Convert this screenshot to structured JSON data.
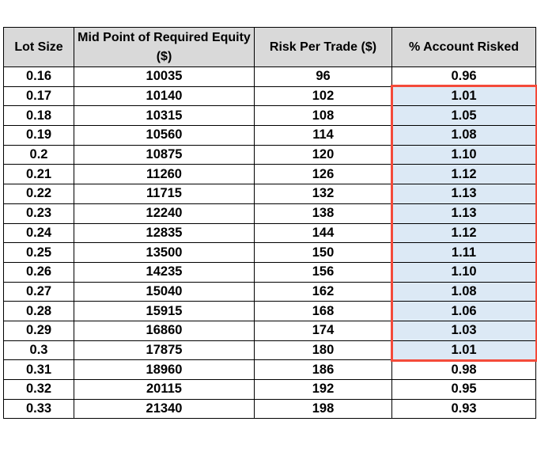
{
  "table": {
    "headers": [
      "Lot Size",
      "Mid Point of Required Equity ($)",
      "Risk Per Trade ($)",
      "% Account Risked"
    ],
    "rows": [
      [
        "0.16",
        "10035",
        "96",
        "0.96"
      ],
      [
        "0.17",
        "10140",
        "102",
        "1.01"
      ],
      [
        "0.18",
        "10315",
        "108",
        "1.05"
      ],
      [
        "0.19",
        "10560",
        "114",
        "1.08"
      ],
      [
        "0.2",
        "10875",
        "120",
        "1.10"
      ],
      [
        "0.21",
        "11260",
        "126",
        "1.12"
      ],
      [
        "0.22",
        "11715",
        "132",
        "1.13"
      ],
      [
        "0.23",
        "12240",
        "138",
        "1.13"
      ],
      [
        "0.24",
        "12835",
        "144",
        "1.12"
      ],
      [
        "0.25",
        "13500",
        "150",
        "1.11"
      ],
      [
        "0.26",
        "14235",
        "156",
        "1.10"
      ],
      [
        "0.27",
        "15040",
        "162",
        "1.08"
      ],
      [
        "0.28",
        "15915",
        "168",
        "1.06"
      ],
      [
        "0.29",
        "16860",
        "174",
        "1.03"
      ],
      [
        "0.3",
        "17875",
        "180",
        "1.01"
      ],
      [
        "0.31",
        "18960",
        "186",
        "0.98"
      ],
      [
        "0.32",
        "20115",
        "192",
        "0.95"
      ],
      [
        "0.33",
        "21340",
        "198",
        "0.93"
      ]
    ],
    "highlight": {
      "column": "% Account Risked",
      "from_lot_size": "0.17",
      "to_lot_size": "0.3",
      "border_color": "#f44a3a",
      "fill_color": "#dce9f5"
    }
  },
  "colors": {
    "header_bg": "#d9d9d9",
    "grid": "#000000"
  }
}
